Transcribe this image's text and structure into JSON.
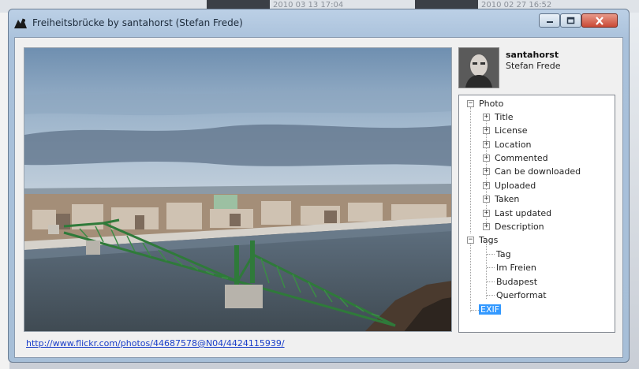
{
  "background": {
    "dates": [
      "2010 03 13 17:04",
      "2010 02 27 16:52"
    ]
  },
  "window": {
    "title": "Freiheitsbrücke by santahorst (Stefan Frede)",
    "controls": {
      "minimize": "minimize",
      "maximize": "maximize",
      "close": "close"
    }
  },
  "photo": {
    "link": "http://www.flickr.com/photos/44687578@N04/4424115939/"
  },
  "author": {
    "username": "santahorst",
    "realname": "Stefan Frede"
  },
  "tree": {
    "photo": {
      "label": "Photo",
      "children": [
        "Title",
        "License",
        "Location",
        "Commented",
        "Can be downloaded",
        "Uploaded",
        "Taken",
        "Last updated",
        "Description"
      ]
    },
    "tags": {
      "label": "Tags",
      "children": [
        "Tag",
        "Im Freien",
        "Budapest",
        "Querformat"
      ]
    },
    "exif": {
      "label": "EXIF",
      "selected": true
    }
  },
  "colors": {
    "selection": "#3399ff",
    "link": "#1a3ec9",
    "bridge": "#2f7a3a"
  }
}
